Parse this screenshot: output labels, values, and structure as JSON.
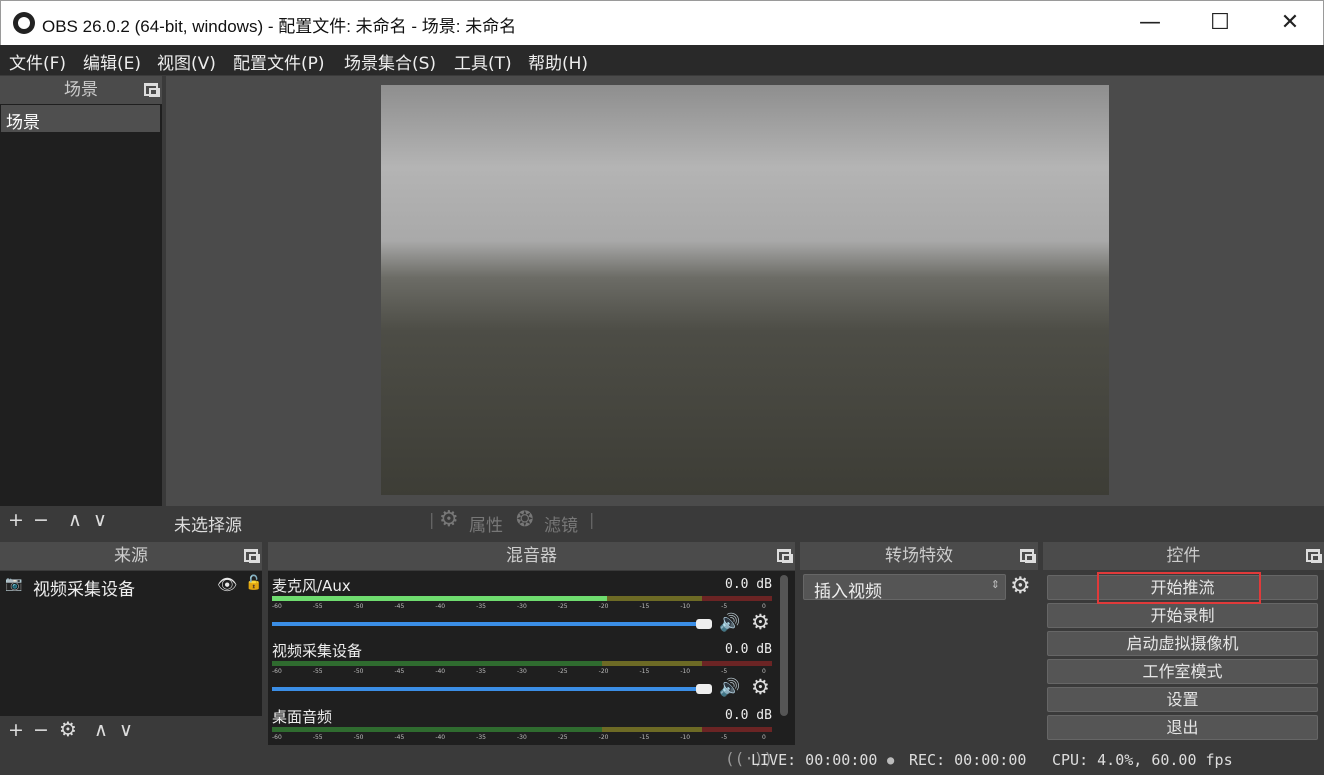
{
  "window": {
    "title": "OBS 26.0.2 (64-bit, windows) - 配置文件: 未命名 - 场景: 未命名",
    "minimize": "—",
    "maximize": "☐",
    "close": "✕"
  },
  "menu": [
    "文件(F)",
    "编辑(E)",
    "视图(V)",
    "配置文件(P)",
    "场景集合(S)",
    "工具(T)",
    "帮助(H)"
  ],
  "scenes": {
    "title": "场景",
    "items": [
      "场景"
    ],
    "toolbar": {
      "add": "+",
      "remove": "−",
      "up": "∧",
      "down": "∨"
    }
  },
  "source_bar": {
    "no_source": "未选择源",
    "properties": "属性",
    "filters": "滤镜"
  },
  "sources": {
    "title": "来源",
    "items": [
      {
        "name": "视频采集设备",
        "visible": true,
        "locked": false
      }
    ],
    "toolbar": {
      "add": "+",
      "remove": "−",
      "settings": "⚙",
      "up": "∧",
      "down": "∨"
    }
  },
  "mixer": {
    "title": "混音器",
    "ticks": [
      "-60",
      "-55",
      "-50",
      "-45",
      "-40",
      "-35",
      "-30",
      "-25",
      "-20",
      "-15",
      "-10",
      "-5",
      "0"
    ],
    "channels": [
      {
        "name": "麦克风/Aux",
        "db": "0.0 dB",
        "level": 0.67,
        "volume": 1.0
      },
      {
        "name": "视频采集设备",
        "db": "0.0 dB",
        "level": 0.0,
        "volume": 1.0
      },
      {
        "name": "桌面音频",
        "db": "0.0 dB",
        "level": 0.0,
        "volume": 1.0
      }
    ]
  },
  "transitions": {
    "title": "转场特效",
    "selected": "插入视频"
  },
  "controls": {
    "title": "控件",
    "buttons": [
      "开始推流",
      "开始录制",
      "启动虚拟摄像机",
      "工作室模式",
      "设置",
      "退出"
    ],
    "highlight_color": "#e03a3a"
  },
  "status": {
    "live": "LIVE: 00:00:00",
    "rec": "REC: 00:00:00",
    "cpu": "CPU: 4.0%, 60.00 fps"
  }
}
